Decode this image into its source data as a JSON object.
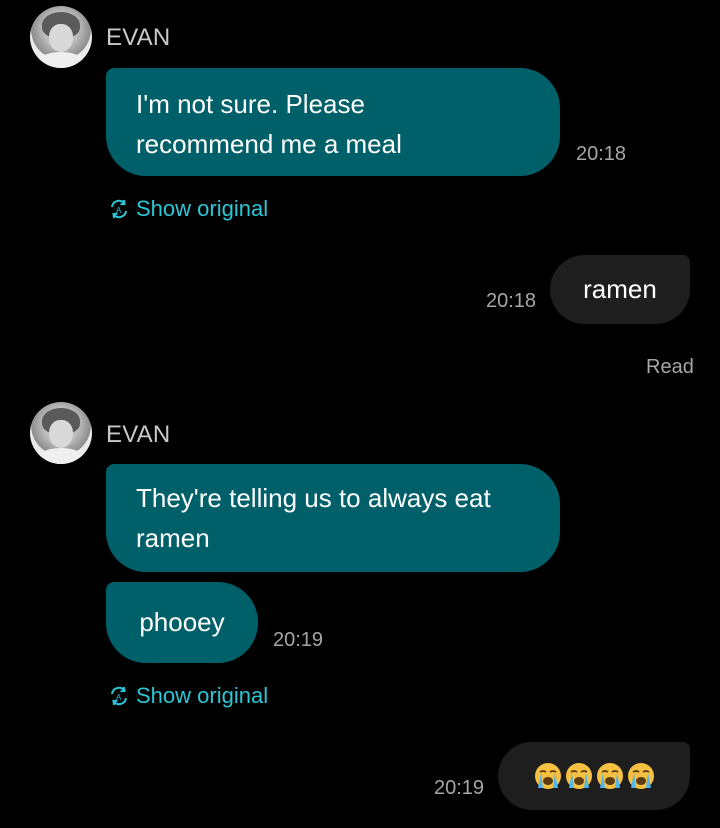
{
  "theme": {
    "background": "#000000",
    "incoming_bubble": "#00606a",
    "outgoing_bubble": "#1e1e1e",
    "link_color": "#2cc6d6",
    "meta_text": "#a6a6a6"
  },
  "messages": [
    {
      "type": "incoming",
      "sender": "EVAN",
      "text_lines": [
        "I'm not sure. Please",
        "recommend me a meal"
      ],
      "time": "20:18",
      "show_original": "Show original"
    },
    {
      "type": "outgoing",
      "text": "ramen",
      "time": "20:18",
      "status": "Read"
    },
    {
      "type": "incoming",
      "sender": "EVAN",
      "bubbles": [
        {
          "text_lines": [
            "They're telling us to always eat",
            "ramen"
          ]
        },
        {
          "text": "phooey",
          "time": "20:19"
        }
      ],
      "show_original": "Show original"
    },
    {
      "type": "outgoing",
      "emoji": [
        "loudly-crying-face",
        "loudly-crying-face",
        "loudly-crying-face",
        "loudly-crying-face"
      ],
      "time": "20:19"
    }
  ]
}
